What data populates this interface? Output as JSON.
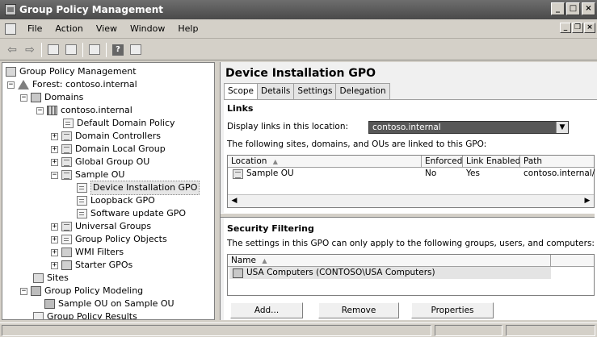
{
  "window": {
    "title": "Group Policy Management",
    "minimize": "_",
    "maximize": "□",
    "close": "×"
  },
  "menubar": {
    "items": [
      "File",
      "Action",
      "View",
      "Window",
      "Help"
    ],
    "mdi_min": "_",
    "mdi_restore": "❐",
    "mdi_close": "×"
  },
  "toolbar": {
    "back_glyph": "⇦",
    "forward_glyph": "⇨",
    "help_glyph": "?"
  },
  "tree": {
    "expanders": {
      "minus": "−",
      "plus": "+"
    },
    "root": "Group Policy Management",
    "forest": "Forest: contoso.internal",
    "domains": "Domains",
    "domain": "contoso.internal",
    "default_policy": "Default Domain Policy",
    "domain_controllers": "Domain Controllers",
    "domain_local_group": "Domain Local Group",
    "global_group_ou": "Global Group OU",
    "sample_ou": "Sample OU",
    "device_installation_gpo": "Device Installation GPO",
    "loopback_gpo": "Loopback GPO",
    "software_update_gpo": "Software update GPO",
    "universal_groups": "Universal Groups",
    "group_policy_objects": "Group Policy Objects",
    "wmi_filters": "WMI Filters",
    "starter_gpos": "Starter GPOs",
    "sites": "Sites",
    "modeling": "Group Policy Modeling",
    "modeling_item": "Sample OU on Sample OU",
    "results": "Group Policy Results"
  },
  "detail": {
    "title": "Device Installation GPO",
    "tabs": [
      "Scope",
      "Details",
      "Settings",
      "Delegation"
    ],
    "links_heading": "Links",
    "display_links_label": "Display links in this location:",
    "location_value": "contoso.internal",
    "combo_arrow": "▼",
    "linked_text": "The following sites, domains, and OUs are linked to this GPO:",
    "links_table": {
      "headers": [
        "Location",
        "Enforced",
        "Link Enabled",
        "Path"
      ],
      "sort_glyph": "▲",
      "rows": [
        {
          "location": "Sample OU",
          "enforced": "No",
          "link_enabled": "Yes",
          "path": "contoso.internal/"
        }
      ],
      "scroll_left": "◀",
      "scroll_right": "▶"
    },
    "security_heading": "Security Filtering",
    "security_text": "The settings in this GPO can only apply to the following groups, users, and computers:",
    "security_table": {
      "headers": [
        "Name"
      ],
      "sort_glyph": "▲",
      "rows": [
        "USA Computers (CONTOSO\\USA Computers)"
      ]
    },
    "buttons": {
      "add": "Add...",
      "remove": "Remove",
      "properties": "Properties"
    }
  }
}
